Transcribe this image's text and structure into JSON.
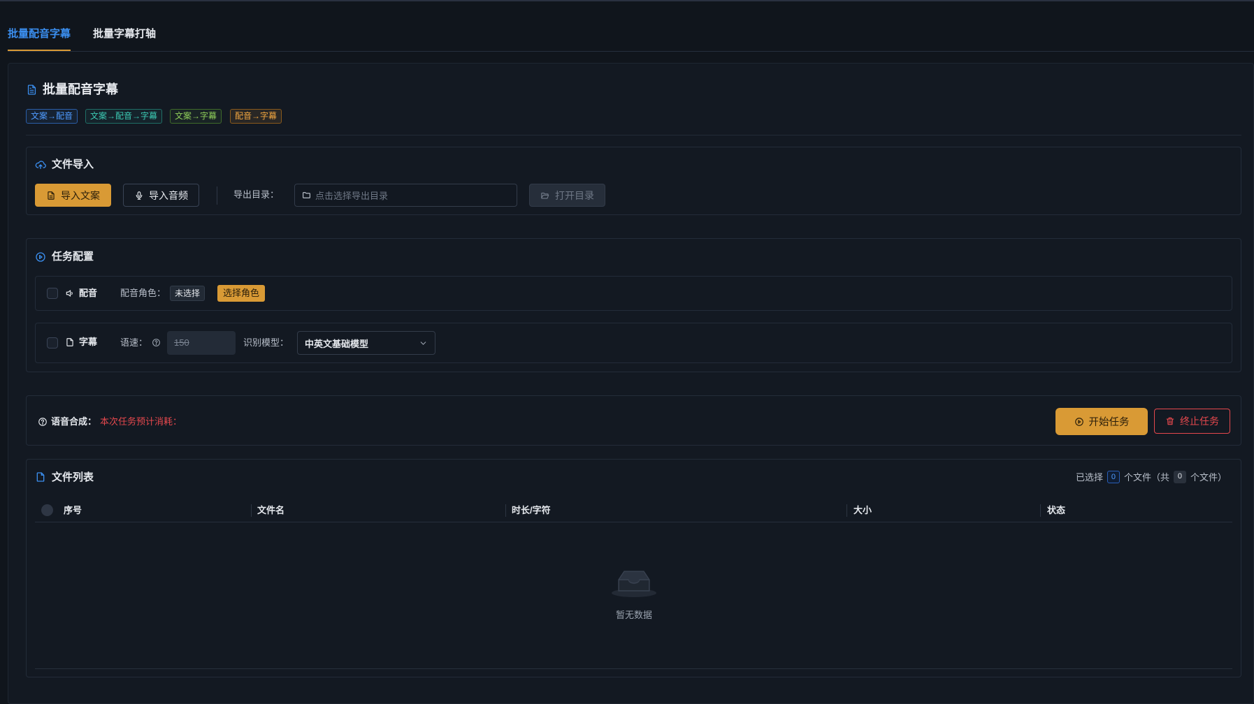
{
  "colors": {
    "accent": "#d99a35",
    "active_tab": "#3b8ff0",
    "danger": "#e5484d",
    "background": "#10151c",
    "panel": "#131922"
  },
  "tabs": [
    {
      "label": "批量配音字幕",
      "active": true
    },
    {
      "label": "批量字幕打轴",
      "active": false
    }
  ],
  "page": {
    "title": "批量配音字幕",
    "title_icon": "document-icon",
    "tags": [
      {
        "label": "文案→配音",
        "color": "#4f9bff"
      },
      {
        "label": "文案→配音→字幕",
        "color": "#3cc9b3"
      },
      {
        "label": "文案→字幕",
        "color": "#8fce5a"
      },
      {
        "label": "配音→字幕",
        "color": "#f0a640"
      }
    ]
  },
  "import": {
    "title": "文件导入",
    "icon": "cloud-upload-icon",
    "import_text_label": "导入文案",
    "import_audio_label": "导入音频",
    "export_dir_label": "导出目录：",
    "export_dir_placeholder": "点击选择导出目录",
    "open_dir_label": "打开目录"
  },
  "config": {
    "title": "任务配置",
    "icon": "play-circle-icon",
    "dub": {
      "label": "配音",
      "checked": false,
      "role_label": "配音角色：",
      "role_value": "未选择",
      "select_role_label": "选择角色"
    },
    "subtitle": {
      "label": "字幕",
      "checked": false,
      "speed_label": "语速：",
      "speed_value": "150",
      "model_label": "识别模型：",
      "model_value": "中英文基础模型"
    }
  },
  "synthesis": {
    "label": "语音合成：",
    "cost_text": "本次任务预计消耗：",
    "start_label": "开始任务",
    "stop_label": "终止任务"
  },
  "files": {
    "title": "文件列表",
    "selected_prefix": "已选择",
    "selected_count": "0",
    "selected_suffix": "个文件（共",
    "total_count": "0",
    "total_suffix": "个文件）",
    "columns": [
      "序号",
      "文件名",
      "时长/字符",
      "大小",
      "状态"
    ],
    "rows": [],
    "empty_text": "暂无数据"
  }
}
